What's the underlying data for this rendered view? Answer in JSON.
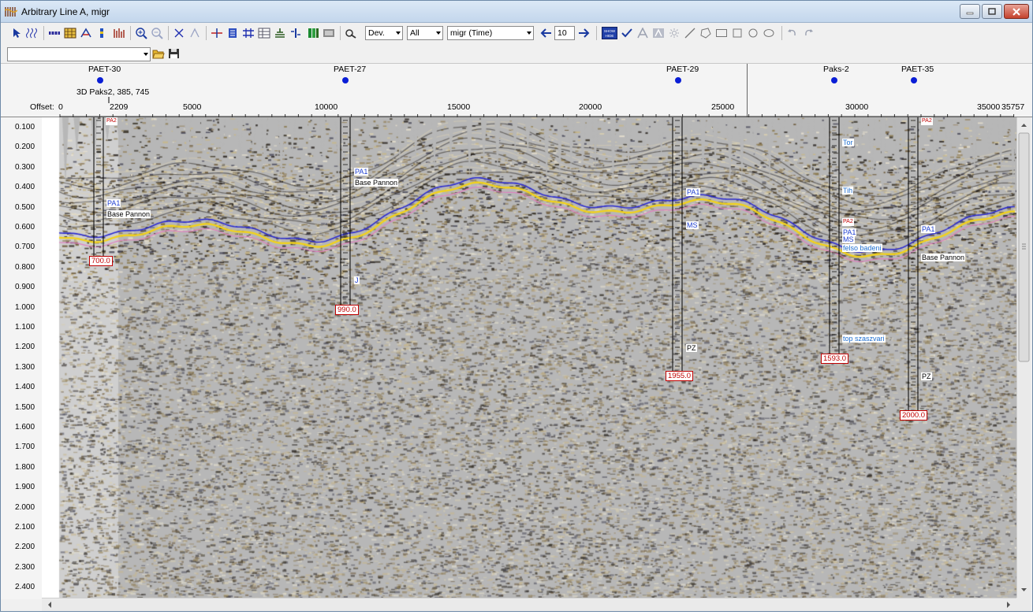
{
  "window": {
    "title": "Arbitrary Line A, migr"
  },
  "toolbar": {
    "display_combo": "Dev.",
    "filter_combo": "All",
    "volume_combo": "migr (Time)",
    "step_value": "10",
    "show_hide_label": "SHOW HIDE"
  },
  "toolbar2": {
    "path_combo": ""
  },
  "header": {
    "offset_label": "Offset:",
    "offset_ticks": [
      "0",
      "2209",
      "5000",
      "10000",
      "15000",
      "20000",
      "25000",
      "30000",
      "35000",
      "35757"
    ],
    "wells": [
      {
        "name": "PAET-30",
        "subtitle": "3D Paks2, 385, 745"
      },
      {
        "name": "PAET-27"
      },
      {
        "name": "PAET-29"
      },
      {
        "name": "Paks-2"
      },
      {
        "name": "PAET-35"
      }
    ]
  },
  "time_axis": {
    "labels": [
      "0.100",
      "0.200",
      "0.300",
      "0.400",
      "0.500",
      "0.600",
      "0.700",
      "0.800",
      "0.900",
      "1.000",
      "1.100",
      "1.200",
      "1.300",
      "1.400",
      "1.500",
      "1.600",
      "1.700",
      "1.800",
      "1.900",
      "2.000",
      "2.100",
      "2.200",
      "2.300",
      "2.400"
    ]
  },
  "markers": {
    "paet30_pa1": "PA1",
    "paet30_base": "Base Pannon",
    "paet30_top": "PA2",
    "paet30_td": "700.0",
    "paet27_pa1": "PA1",
    "paet27_base": "Base Pannon",
    "paet27_j": "J",
    "paet27_td": "990.0",
    "paet29_pa1": "PA1",
    "paet29_ms": "MS",
    "paet29_pz": "PZ",
    "paet29_td": "1955.0",
    "paks2_tor": "Tor",
    "paks2_tih": "Tih",
    "paks2_pa2": "PA2",
    "paks2_pa1": "PA1",
    "paks2_ms": "MS",
    "paks2_felso": "felso badeni",
    "paks2_top": "top szaszvari",
    "paks2_td": "1593.0",
    "paet35_top": "PA2",
    "paet35_pa1": "PA1",
    "paet35_base": "Base Pannon",
    "paet35_pz": "PZ",
    "paet35_td": "2000.0"
  },
  "colors": {
    "horizon_yellow": "#f2d21a",
    "horizon_blue": "#2a2ad0",
    "horizon_pink": "#e080c0",
    "well_dot": "#0a1ed6",
    "td_label": "#c00000",
    "marker_blue": "#1f6fd0"
  }
}
